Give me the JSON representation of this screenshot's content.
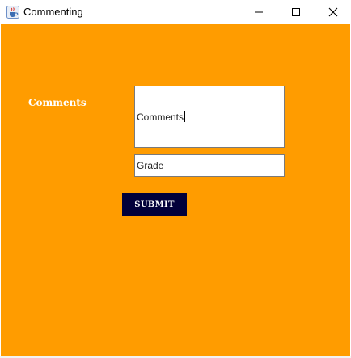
{
  "window": {
    "title": "Commenting",
    "icons": {
      "app": "java-cup-icon",
      "minimize": "minimize-icon",
      "maximize": "maximize-icon",
      "close": "close-icon"
    }
  },
  "form": {
    "comments_label": "Comments",
    "comments_value": "Comments",
    "grade_value": "Grade",
    "submit_label": "SUBMIT"
  },
  "colors": {
    "background": "#ff9c00",
    "label_text": "#ffffff",
    "submit_bg": "#02003a",
    "submit_text": "#ffffff"
  }
}
